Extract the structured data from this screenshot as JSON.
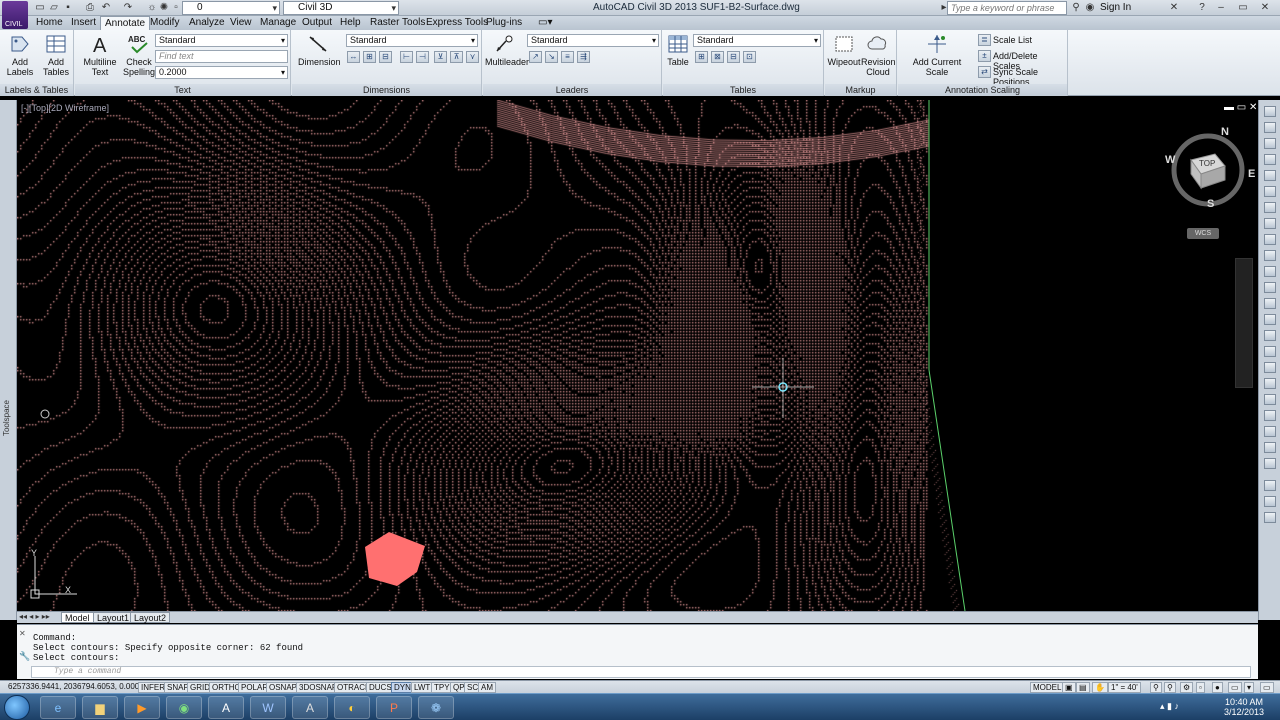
{
  "titlebar": {
    "title": "AutoCAD Civil 3D 2013    SUF1-B2-Surface.dwg",
    "layer_value": "0",
    "workspace_value": "Civil 3D",
    "search_placeholder": "Type a keyword or phrase",
    "sign_in": "Sign In",
    "app_logo_text": "CIVIL"
  },
  "menu": {
    "tabs": [
      "Home",
      "Insert",
      "Annotate",
      "Modify",
      "Analyze",
      "View",
      "Manage",
      "Output",
      "Help",
      "Raster Tools",
      "Express Tools",
      "Plug-ins"
    ],
    "active_tab": "Annotate"
  },
  "ribbon": {
    "labels_tables": {
      "title": "Labels & Tables",
      "add_labels": "Add Labels",
      "add_tables": "Add Tables"
    },
    "text": {
      "title": "Text",
      "multiline": "Multiline Text",
      "check": "Check Spelling",
      "style": "Standard",
      "find_placeholder": "Find text",
      "height": "0.2000"
    },
    "dimensions": {
      "title": "Dimensions",
      "dimension": "Dimension",
      "style": "Standard"
    },
    "leaders": {
      "title": "Leaders",
      "multileader": "Multileader",
      "style": "Standard"
    },
    "tables": {
      "title": "Tables",
      "table": "Table",
      "style": "Standard"
    },
    "markup": {
      "title": "Markup",
      "wipeout": "Wipeout",
      "revision": "Revision Cloud"
    },
    "annotation_scaling": {
      "title": "Annotation Scaling",
      "add_current": "Add Current Scale",
      "scale_list": "Scale List",
      "add_delete": "Add/Delete Scales",
      "sync": "Sync Scale Positions"
    }
  },
  "viewport": {
    "label": "[-][Top][2D Wireframe]",
    "viewcube": {
      "face": "TOP",
      "n": "N",
      "s": "S",
      "e": "E",
      "w": "W"
    },
    "wcs": "WCS",
    "ucs_y": "Y",
    "ucs_x": "X"
  },
  "toolspace_label": "Toolspace",
  "layout_tabs": [
    "Model",
    "Layout1",
    "Layout2"
  ],
  "command": {
    "lines": [
      "Command:",
      "Select contours: Specify opposite corner: 62 found",
      "Select contours:"
    ],
    "placeholder": "Type a command"
  },
  "status": {
    "coords": "6257336.9441, 2036794.6053, 0.0000",
    "toggles": [
      "INFER",
      "SNAP",
      "GRID",
      "ORTHO",
      "POLAR",
      "OSNAP",
      "3DOSNAP",
      "OTRACK",
      "DUCS",
      "DYN",
      "LWT",
      "TPY",
      "QP",
      "SC",
      "AM"
    ],
    "model": "MODEL",
    "scale": "1\" = 40'"
  },
  "taskbar": {
    "time": "10:40 AM",
    "date": "3/12/2013"
  },
  "colors": {
    "contour": "#f0a0a0",
    "boundary": "#5bd06a",
    "highlight": "#ff7070"
  }
}
